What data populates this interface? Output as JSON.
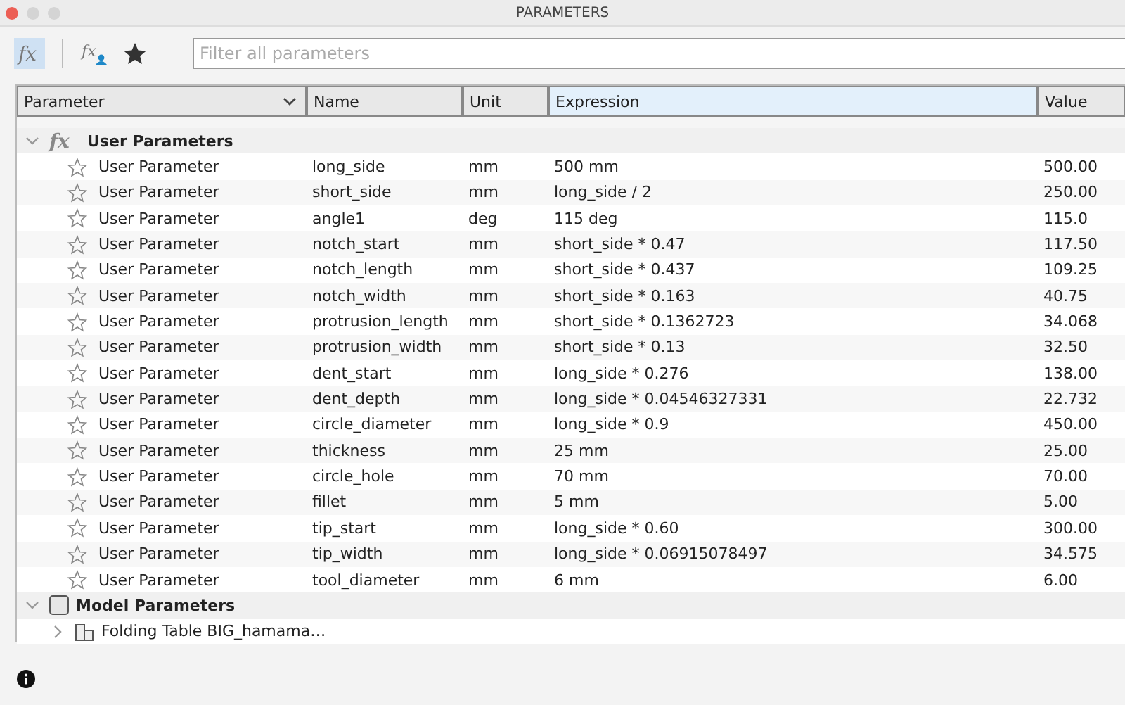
{
  "window": {
    "title": "PARAMETERS"
  },
  "toolbar": {
    "buttons": [
      {
        "kind": "fx",
        "glyph": "fx",
        "selected": true
      },
      {
        "kind": "user-fx",
        "glyph": "fx",
        "selected": false
      },
      {
        "kind": "star",
        "selected": false
      }
    ],
    "filter": {
      "placeholder": "Filter all parameters"
    }
  },
  "table": {
    "columns": [
      {
        "label": "Parameter",
        "dropdown": true,
        "selected": false
      },
      {
        "label": "Name",
        "dropdown": false,
        "selected": false
      },
      {
        "label": "Unit",
        "dropdown": false,
        "selected": false
      },
      {
        "label": "Expression",
        "dropdown": false,
        "selected": true
      },
      {
        "label": "Value",
        "dropdown": false,
        "selected": false
      }
    ],
    "groups": [
      {
        "kind": "user",
        "glyph": "fx",
        "label": "User Parameters",
        "expanded": true,
        "children": [
          {
            "parameter": "User Parameter",
            "favorite": false,
            "name": "long_side",
            "unit": "mm",
            "expression": "500 mm",
            "value": "500.00"
          },
          {
            "parameter": "User Parameter",
            "favorite": false,
            "name": "short_side",
            "unit": "mm",
            "expression": "long_side / 2",
            "value": "250.00"
          },
          {
            "parameter": "User Parameter",
            "favorite": false,
            "name": "angle1",
            "unit": "deg",
            "expression": "115 deg",
            "value": "115.0"
          },
          {
            "parameter": "User Parameter",
            "favorite": false,
            "name": "notch_start",
            "unit": "mm",
            "expression": "short_side * 0.47",
            "value": "117.50"
          },
          {
            "parameter": "User Parameter",
            "favorite": false,
            "name": "notch_length",
            "unit": "mm",
            "expression": "short_side * 0.437",
            "value": "109.25"
          },
          {
            "parameter": "User Parameter",
            "favorite": false,
            "name": "notch_width",
            "unit": "mm",
            "expression": "short_side * 0.163",
            "value": "40.75"
          },
          {
            "parameter": "User Parameter",
            "favorite": false,
            "name": "protrusion_length",
            "unit": "mm",
            "expression": "short_side * 0.1362723",
            "value": "34.068"
          },
          {
            "parameter": "User Parameter",
            "favorite": false,
            "name": "protrusion_width",
            "unit": "mm",
            "expression": "short_side * 0.13",
            "value": "32.50"
          },
          {
            "parameter": "User Parameter",
            "favorite": false,
            "name": "dent_start",
            "unit": "mm",
            "expression": "long_side * 0.276",
            "value": "138.00"
          },
          {
            "parameter": "User Parameter",
            "favorite": false,
            "name": "dent_depth",
            "unit": "mm",
            "expression": "long_side * 0.04546327331",
            "value": "22.732"
          },
          {
            "parameter": "User Parameter",
            "favorite": false,
            "name": "circle_diameter",
            "unit": "mm",
            "expression": "long_side * 0.9",
            "value": "450.00"
          },
          {
            "parameter": "User Parameter",
            "favorite": false,
            "name": "thickness",
            "unit": "mm",
            "expression": "25 mm",
            "value": "25.00"
          },
          {
            "parameter": "User Parameter",
            "favorite": false,
            "name": "circle_hole",
            "unit": "mm",
            "expression": "70 mm",
            "value": "70.00"
          },
          {
            "parameter": "User Parameter",
            "favorite": false,
            "name": "fillet",
            "unit": "mm",
            "expression": "5 mm",
            "value": "5.00"
          },
          {
            "parameter": "User Parameter",
            "favorite": false,
            "name": "tip_start",
            "unit": "mm",
            "expression": "long_side * 0.60",
            "value": "300.00"
          },
          {
            "parameter": "User Parameter",
            "favorite": false,
            "name": "tip_width",
            "unit": "mm",
            "expression": "long_side * 0.06915078497",
            "value": "34.575"
          },
          {
            "parameter": "User Parameter",
            "favorite": false,
            "name": "tool_diameter",
            "unit": "mm",
            "expression": "6 mm",
            "value": "6.00"
          }
        ]
      },
      {
        "kind": "model",
        "label": "Model Parameters",
        "expanded": true,
        "children": [
          {
            "label": "Folding Table BIG_hamama…",
            "expanded": false
          }
        ]
      }
    ]
  }
}
